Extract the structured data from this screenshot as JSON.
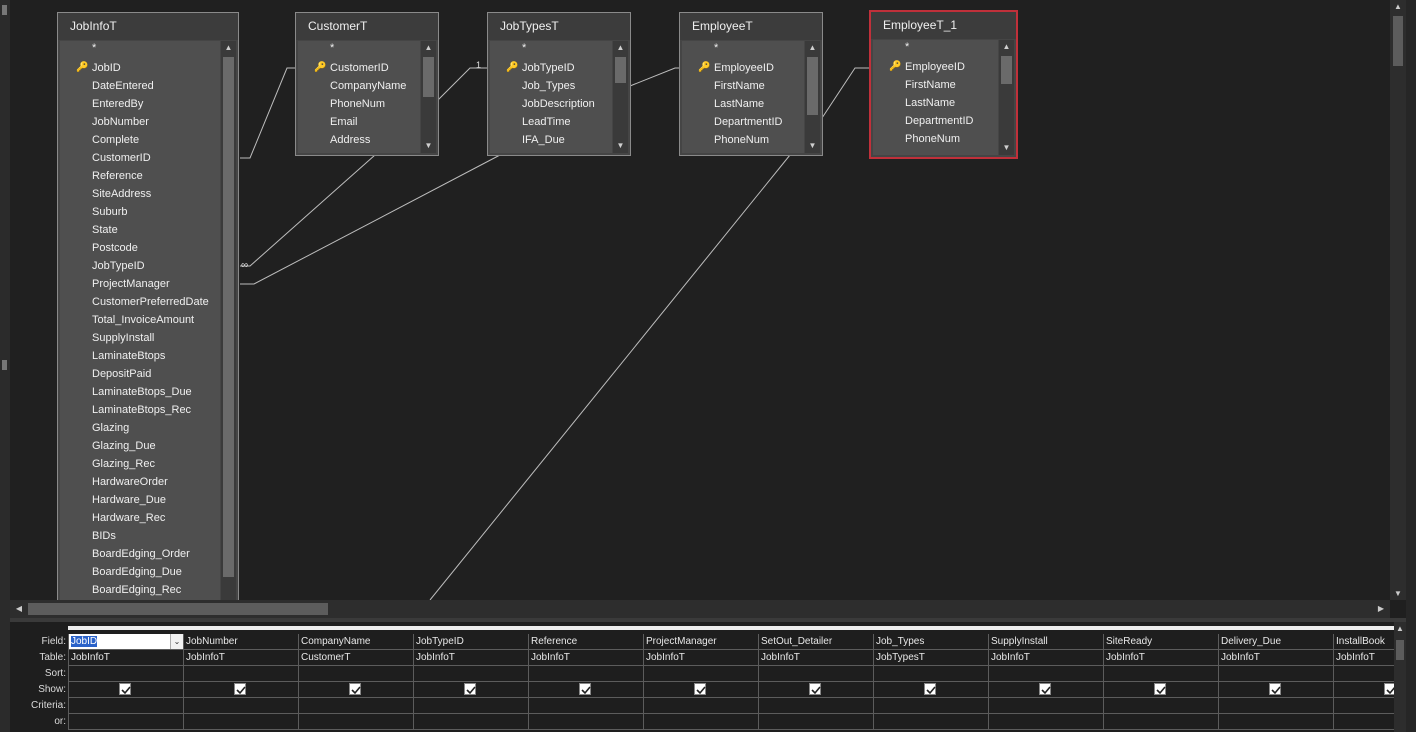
{
  "tables": [
    {
      "name": "JobInfoT",
      "key_field": "JobID",
      "fields": [
        "*",
        "JobID",
        "DateEntered",
        "EnteredBy",
        "JobNumber",
        "Complete",
        "CustomerID",
        "Reference",
        "SiteAddress",
        "Suburb",
        "State",
        "Postcode",
        "JobTypeID",
        "ProjectManager",
        "CustomerPreferredDate",
        "Total_InvoiceAmount",
        "SupplyInstall",
        "LaminateBtops",
        "DepositPaid",
        "LaminateBtops_Due",
        "LaminateBtops_Rec",
        "Glazing",
        "Glazing_Due",
        "Glazing_Rec",
        "HardwareOrder",
        "Hardware_Due",
        "Hardware_Rec",
        "BIDs",
        "BoardEdging_Order",
        "BoardEdging_Due",
        "BoardEdging_Rec"
      ]
    },
    {
      "name": "CustomerT",
      "key_field": "CustomerID",
      "fields": [
        "*",
        "CustomerID",
        "CompanyName",
        "PhoneNum",
        "Email",
        "Address"
      ]
    },
    {
      "name": "JobTypesT",
      "key_field": "JobTypeID",
      "fields": [
        "*",
        "JobTypeID",
        "Job_Types",
        "JobDescription",
        "LeadTime",
        "IFA_Due"
      ]
    },
    {
      "name": "EmployeeT",
      "key_field": "EmployeeID",
      "fields": [
        "*",
        "EmployeeID",
        "FirstName",
        "LastName",
        "DepartmentID",
        "PhoneNum"
      ]
    },
    {
      "name": "EmployeeT_1",
      "key_field": "EmployeeID",
      "fields": [
        "*",
        "EmployeeID",
        "FirstName",
        "LastName",
        "DepartmentID",
        "PhoneNum"
      ]
    }
  ],
  "relationship_markers": {
    "one": "1",
    "many": "∞"
  },
  "grid": {
    "row_labels": [
      "Field:",
      "Table:",
      "Sort:",
      "Show:",
      "Criteria:",
      "or:"
    ],
    "columns": [
      {
        "field": "JobID",
        "table": "JobInfoT",
        "show": true
      },
      {
        "field": "JobNumber",
        "table": "JobInfoT",
        "show": true
      },
      {
        "field": "CompanyName",
        "table": "CustomerT",
        "show": true
      },
      {
        "field": "JobTypeID",
        "table": "JobInfoT",
        "show": true
      },
      {
        "field": "Reference",
        "table": "JobInfoT",
        "show": true
      },
      {
        "field": "ProjectManager",
        "table": "JobInfoT",
        "show": true
      },
      {
        "field": "SetOut_Detailer",
        "table": "JobInfoT",
        "show": true
      },
      {
        "field": "Job_Types",
        "table": "JobTypesT",
        "show": true
      },
      {
        "field": "SupplyInstall",
        "table": "JobInfoT",
        "show": true
      },
      {
        "field": "SiteReady",
        "table": "JobInfoT",
        "show": true
      },
      {
        "field": "Delivery_Due",
        "table": "JobInfoT",
        "show": true
      },
      {
        "field": "InstallBook",
        "table": "JobInfoT",
        "show": true
      }
    ]
  },
  "icons": {
    "key": "key-icon",
    "checkbox": "checkmark-icon"
  },
  "colors": {
    "canvas": "#202020",
    "table_bg": "#454545",
    "selected_border": "#c0303a"
  }
}
